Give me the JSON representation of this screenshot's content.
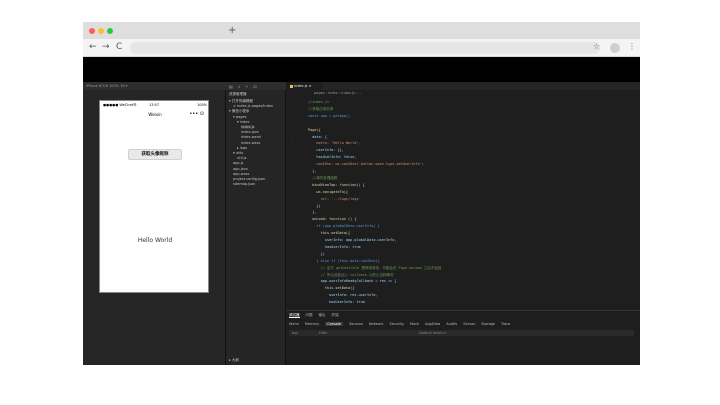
{
  "browser": {
    "new_tab_icon": "plus-icon",
    "traffic_lights": [
      "#ff5f56",
      "#ffbd2e",
      "#27c93f"
    ],
    "back_icon": "←",
    "forward_icon": "→",
    "reload_icon": "C",
    "star_icon": "☆",
    "menu_icon": "⋮"
  },
  "simulator": {
    "toolbar_label": "iPhone 6/7/8 100% 16 ▾",
    "status_left": "●●●●● WeChat令",
    "status_time": "13:57",
    "status_right": "100%",
    "nav_title": "Weixin",
    "capsule": "••• ⊙",
    "auth_button": "获取头像昵称",
    "hello_text": "Hello World"
  },
  "explorer": {
    "title": "资源管理器",
    "items": [
      {
        "label": "▾ 打开的编辑器",
        "indent": 0
      },
      {
        "label": "× index.js pages/index",
        "indent": 1
      },
      {
        "label": "▾ 微信小程序",
        "indent": 0
      },
      {
        "label": "▾ pages",
        "indent": 1
      },
      {
        "label": "▾ index",
        "indent": 2
      },
      {
        "label": "index.js",
        "indent": 3,
        "selected": true
      },
      {
        "label": "index.json",
        "indent": 3
      },
      {
        "label": "index.wxml",
        "indent": 3
      },
      {
        "label": "index.wxss",
        "indent": 3
      },
      {
        "label": "▸ logs",
        "indent": 2
      },
      {
        "label": "▾ utils",
        "indent": 1
      },
      {
        "label": "util.js",
        "indent": 2
      },
      {
        "label": "app.js",
        "indent": 1
      },
      {
        "label": "app.json",
        "indent": 1
      },
      {
        "label": "app.wxss",
        "indent": 1
      },
      {
        "label": "project.config.json",
        "indent": 1
      },
      {
        "label": "sitemap.json",
        "indent": 1
      }
    ],
    "outline": "▸ 大纲"
  },
  "editor": {
    "tab_label": "index.js",
    "breadcrumb": "pages › index › index.js › ...",
    "lines": [
      {
        "t": "//index.js",
        "c": "com"
      },
      {
        "t": "//获取应用实例",
        "c": "com"
      },
      {
        "t": "const app = getApp()",
        "c": "key"
      },
      {
        "t": "",
        "c": ""
      },
      {
        "t": "Page({",
        "c": "fn"
      },
      {
        "t": "  data: {",
        "c": "prop"
      },
      {
        "t": "    motto: 'Hello World',",
        "c": "str"
      },
      {
        "t": "    userInfo: {},",
        "c": "prop"
      },
      {
        "t": "    hasUserInfo: false,",
        "c": "prop"
      },
      {
        "t": "    canIUse: wx.canIUse('button.open-type.getUserInfo')",
        "c": "str"
      },
      {
        "t": "  },",
        "c": ""
      },
      {
        "t": "  //事件处理函数",
        "c": "com"
      },
      {
        "t": "  bindViewTap: function() {",
        "c": "fn"
      },
      {
        "t": "    wx.navigateTo({",
        "c": "fn"
      },
      {
        "t": "      url: '../logs/logs'",
        "c": "str"
      },
      {
        "t": "    })",
        "c": ""
      },
      {
        "t": "  },",
        "c": ""
      },
      {
        "t": "  onLoad: function () {",
        "c": "fn"
      },
      {
        "t": "    if (app.globalData.userInfo) {",
        "c": "key"
      },
      {
        "t": "      this.setData({",
        "c": "fn"
      },
      {
        "t": "        userInfo: app.globalData.userInfo,",
        "c": "prop"
      },
      {
        "t": "        hasUserInfo: true",
        "c": "prop"
      },
      {
        "t": "      })",
        "c": ""
      },
      {
        "t": "    } else if (this.data.canIUse){",
        "c": "key"
      },
      {
        "t": "      // 由于 getUserInfo 是网络请求，可能会在 Page.onLoad 之后才返回",
        "c": "com"
      },
      {
        "t": "      // 所以此处加入 callback 以防止这种情况",
        "c": "com"
      },
      {
        "t": "      app.userInfoReadyCallback = res => {",
        "c": "prop"
      },
      {
        "t": "        this.setData({",
        "c": "fn"
      },
      {
        "t": "          userInfo: res.userInfo,",
        "c": "prop"
      },
      {
        "t": "          hasUserInfo: true",
        "c": "prop"
      }
    ]
  },
  "panel": {
    "tabs": [
      "调试器",
      "问题",
      "输出",
      "终端"
    ],
    "active_tab": "调试器",
    "devtools_tabs": [
      "Wxml",
      "Memory",
      "Console",
      "Sources",
      "Network",
      "Security",
      "Mock",
      "AppData",
      "Audits",
      "Sensor",
      "Storage",
      "Trace"
    ],
    "active_devtool": "Console",
    "filter_context": "top",
    "filter_placeholder": "Filter",
    "filter_levels": "Default levels ▾"
  }
}
